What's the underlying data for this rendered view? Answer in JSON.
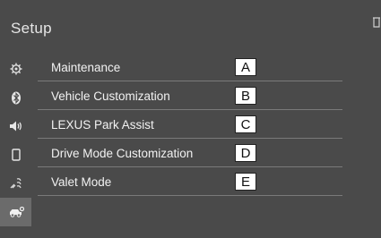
{
  "header": {
    "title": "Setup"
  },
  "sidebar": {
    "icons": [
      "gear-icon",
      "bluetooth-icon",
      "speaker-icon",
      "phone-icon",
      "car-settings-icon",
      "vehicle-icon"
    ],
    "active_index": 5
  },
  "menu": {
    "items": [
      {
        "label": "Maintenance",
        "callout": "A"
      },
      {
        "label": "Vehicle Customization",
        "callout": "B"
      },
      {
        "label": "LEXUS Park Assist",
        "callout": "C"
      },
      {
        "label": "Drive Mode Customization",
        "callout": "D"
      },
      {
        "label": "Valet Mode",
        "callout": "E"
      }
    ]
  },
  "colors": {
    "background": "#4a4a4a",
    "text": "#f2f2f2",
    "divider": "#7a7a7a",
    "active_tab": "#6b6b6b"
  }
}
